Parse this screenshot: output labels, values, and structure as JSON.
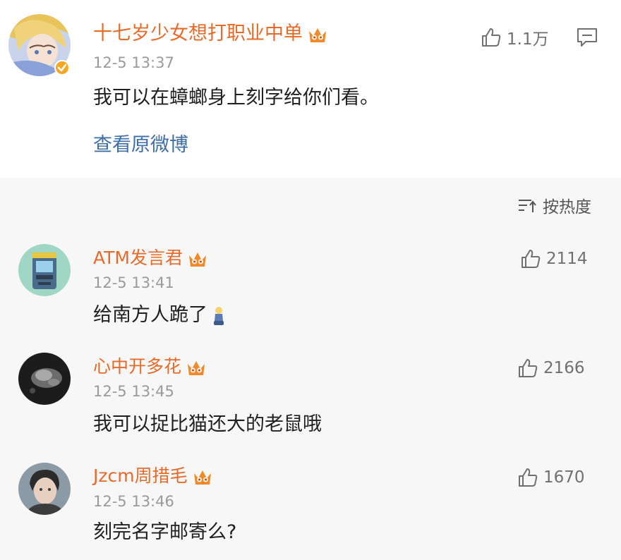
{
  "main_comment": {
    "username": "十七岁少女想打职业中单",
    "time": "12-5 13:37",
    "text": "我可以在蟑螂身上刻字给你们看。",
    "view_original": "查看原微博",
    "likes": "1.1万",
    "avatar_icon": "anime-girl-avatar",
    "verified_badge": "verified-badge-icon"
  },
  "sort": {
    "label": "按热度",
    "icon": "sort-icon"
  },
  "replies": [
    {
      "username": "ATM发言君",
      "time": "12-5 13:41",
      "text": "给南方人跪了",
      "emoji": "kneeling-emoji",
      "likes": "2114",
      "avatar_icon": "atm-machine-avatar"
    },
    {
      "username": "心中开多花",
      "time": "12-5 13:45",
      "text": "我可以捉比猫还大的老鼠哦",
      "likes": "2166",
      "avatar_icon": "dark-photo-avatar"
    },
    {
      "username": "Jzcm周措毛",
      "time": "12-5 13:46",
      "text": "刻完名字邮寄么?",
      "likes": "1670",
      "avatar_icon": "young-man-avatar"
    }
  ],
  "colors": {
    "username": "#e86a28",
    "link": "#3d6ea8",
    "time": "#9a9a9a",
    "reply_bg": "#f7f7f7"
  }
}
